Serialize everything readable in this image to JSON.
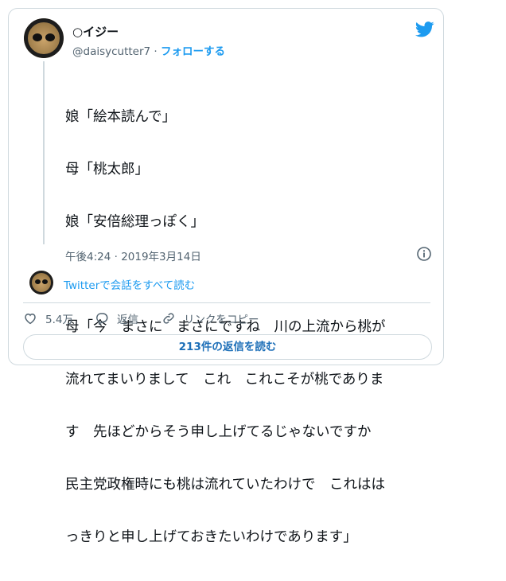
{
  "user": {
    "display_name": "○イジー",
    "handle": "@daisycutter7",
    "separator": " · ",
    "follow_label": "フォローする"
  },
  "tweet": {
    "lines": [
      "娘「絵本読んで」",
      "母「桃太郎」",
      "娘「安倍総理っぽく」",
      "",
      "母「今　まさに　まさにですね　川の上流から桃が",
      "流れてまいりまして　これ　これこそが桃でありま",
      "す　先ほどからそう申し上げてるじゃないですか",
      "民主党政権時にも桃は流れていたわけで　これはは",
      "っきりと申し上げておきたいわけであります」"
    ],
    "timestamp": "午後4:24 · 2019年3月14日"
  },
  "conversation": {
    "label": "Twitterで会話をすべて読む"
  },
  "actions": {
    "like_count": "5.4万",
    "reply_label": "返信",
    "copy_link_label": "リンクをコピー"
  },
  "replies_button": {
    "label": "213件の返信を読む"
  },
  "colors": {
    "accent": "#1d9bf0",
    "muted": "#536471",
    "border": "#cfd9de"
  },
  "icons": [
    "twitter-bird-icon",
    "info-icon",
    "heart-icon",
    "reply-bubble-icon",
    "link-icon"
  ]
}
